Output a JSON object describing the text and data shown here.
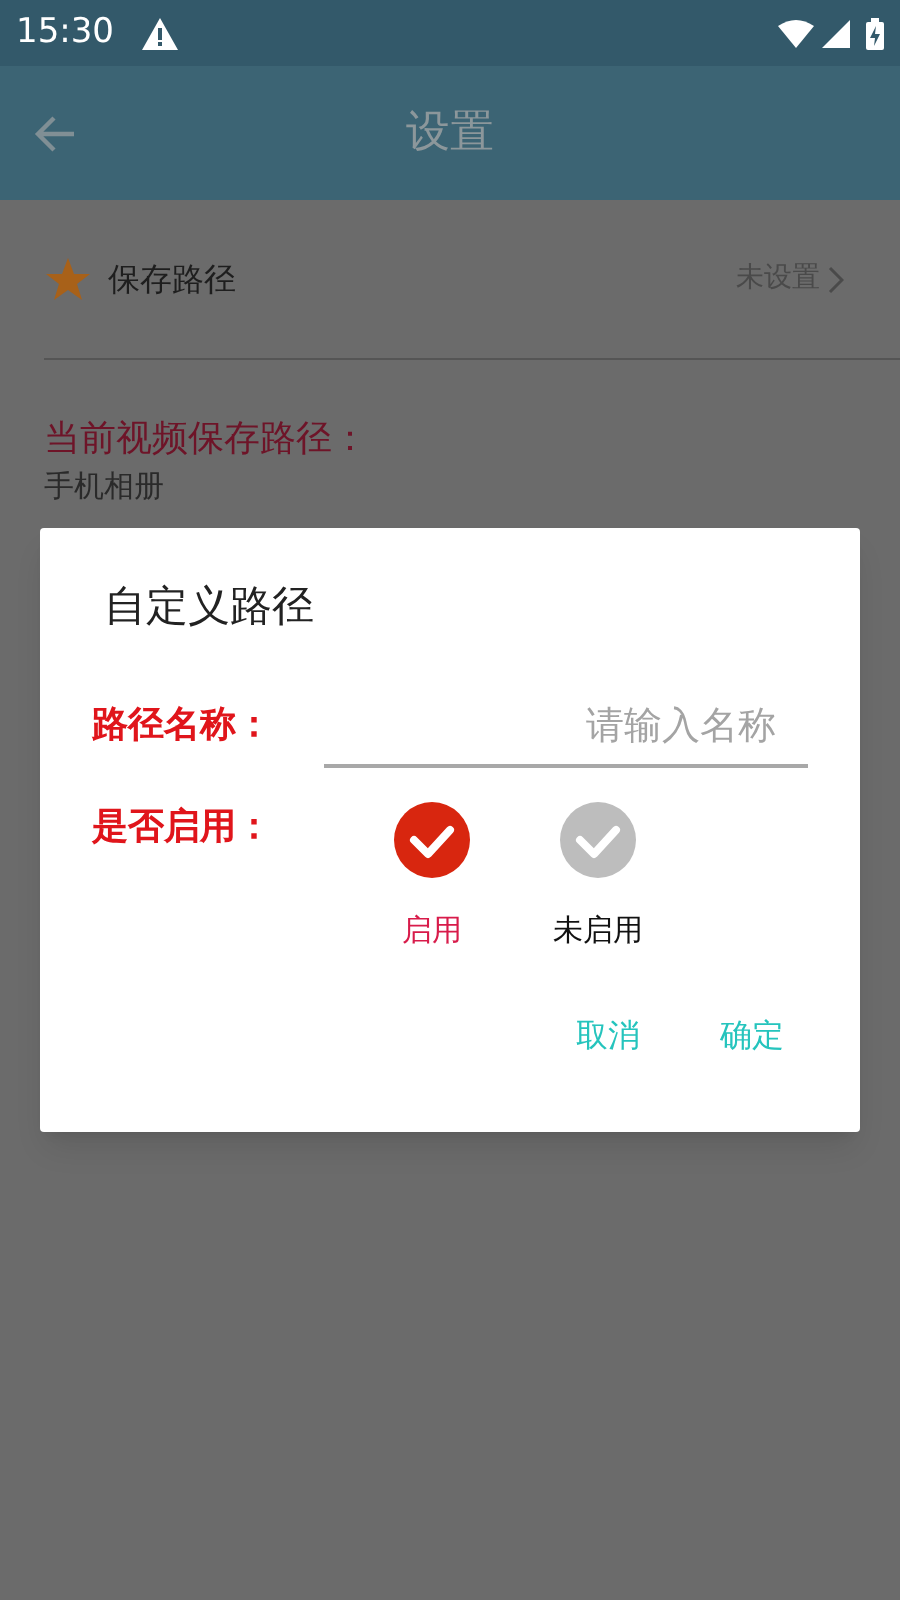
{
  "status_bar": {
    "time": "15:30"
  },
  "app_bar": {
    "title": "设置"
  },
  "settings": {
    "item": {
      "label": "保存路径",
      "value": "未设置"
    },
    "current_path_label": "当前视频保存路径：",
    "current_path": "手机相册"
  },
  "dialog": {
    "title": "自定义路径",
    "name_label": "路径名称：",
    "name_field": {
      "placeholder": "请输入名称"
    },
    "enable_label": "是否启用：",
    "options": [
      {
        "label": "启用",
        "selected": true
      },
      {
        "label": "未启用",
        "selected": false
      }
    ],
    "buttons": [
      "取消",
      "确定"
    ]
  }
}
